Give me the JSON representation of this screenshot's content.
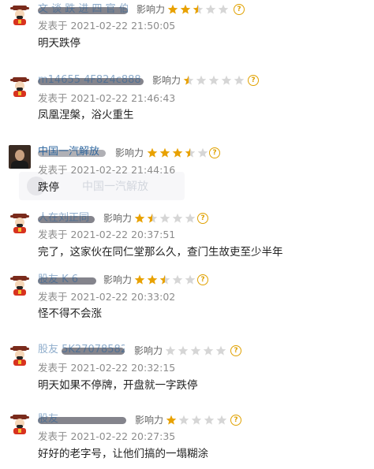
{
  "colors": {
    "star_filled": "#e8a100",
    "star_empty": "#d6d6d6",
    "username": "#1f5c99",
    "help": "#e0a100"
  },
  "labels": {
    "influence": "影响力",
    "help_glyph": "?"
  },
  "watermark": {
    "text": "中国一汽解放"
  },
  "comments": [
    {
      "username": "文 谈 跌 进 四 官 伯 适",
      "avatar": "fortune-god-avatar",
      "rating": 2.5,
      "time": "发表于 2021-02-22 21:50:05",
      "text": "明天跌停"
    },
    {
      "username": "m14655 4F824c888",
      "avatar": "fortune-god-avatar",
      "rating": 0.5,
      "time": "发表于 2021-02-22 21:46:43",
      "text": "凤凰涅槃，浴火重生"
    },
    {
      "username": "中国一汽解放",
      "avatar": "photo-avatar",
      "rating": 3.5,
      "time": "发表于 2021-02-22 21:44:16",
      "text": "跌停"
    },
    {
      "username": "人在刘正同",
      "avatar": "fortune-god-avatar",
      "rating": 1.5,
      "time": "发表于 2021-02-22 20:37:51",
      "text": "完了，这家伙在同仁堂那么久，查门生故吏至少半年"
    },
    {
      "username": "股友 K 6",
      "avatar": "fortune-god-avatar",
      "rating": 2.5,
      "time": "发表于 2021-02-22 20:33:02",
      "text": "怪不得不会涨"
    },
    {
      "username": "股友 5K27078582",
      "avatar": "fortune-god-avatar",
      "rating": 0,
      "time": "发表于 2021-02-22 20:32:15",
      "text": "明天如果不停牌，开盘就一字跌停"
    },
    {
      "username": "股友",
      "avatar": "fortune-god-avatar",
      "rating": 1,
      "time": "发表于 2021-02-22 20:27:35",
      "text": "好好的老字号，让他们搞的一塌糊涂"
    }
  ]
}
